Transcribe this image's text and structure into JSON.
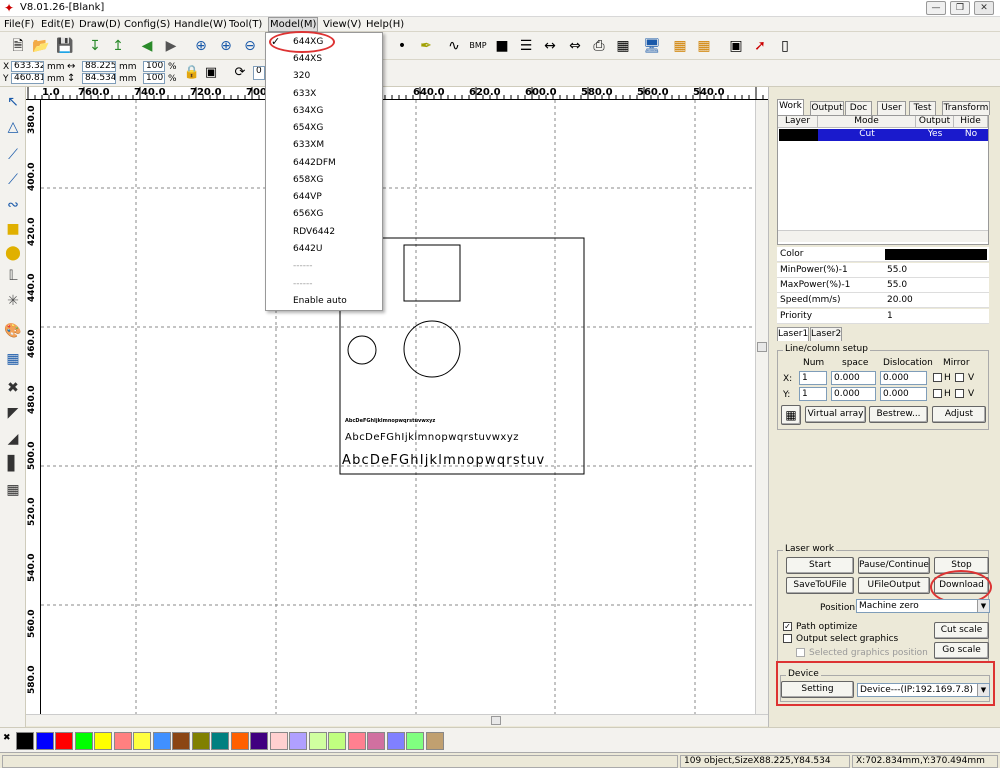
{
  "title": "V8.01.26-[Blank]",
  "menu": [
    {
      "name": "menu-file",
      "label": "File(F)"
    },
    {
      "name": "menu-edit",
      "label": "Edit(E)"
    },
    {
      "name": "menu-draw",
      "label": "Draw(D)"
    },
    {
      "name": "menu-config",
      "label": "Config(S)"
    },
    {
      "name": "menu-handle",
      "label": "Handle(W)"
    },
    {
      "name": "menu-tool",
      "label": "Tool(T)"
    },
    {
      "name": "menu-model",
      "label": "Model(M)"
    },
    {
      "name": "menu-view",
      "label": "View(V)"
    },
    {
      "name": "menu-help",
      "label": "Help(H)"
    }
  ],
  "coords": {
    "x_label": "X",
    "x_value": "633.326",
    "x_unit": "mm",
    "y_label": "Y",
    "y_value": "460.811",
    "y_unit": "mm",
    "w_value": "88.225",
    "w_unit": "mm",
    "h_value": "84.534",
    "h_unit": "mm",
    "sx_value": "100",
    "sx_unit": "%",
    "sy_value": "100",
    "sy_unit": "%",
    "rot_value": "0"
  },
  "model_menu": {
    "checked": "644XG",
    "items": [
      "644XG",
      "644XS",
      "320",
      "633X",
      "634XG",
      "654XG",
      "633XM",
      "6442DFM",
      "658XG",
      "644VP",
      "656XG",
      "RDV6442",
      "6442U",
      "------",
      "------",
      "Enable auto"
    ]
  },
  "ruler_h": [
    "1.0",
    "760.0",
    "740.0",
    "720.0",
    "700",
    "640.0",
    "620.0",
    "600.0",
    "580.0",
    "560.0",
    "540.0"
  ],
  "ruler_v": [
    "380.0",
    "400.0",
    "420.0",
    "440.0",
    "460.0",
    "480.0",
    "500.0",
    "520.0",
    "540.0",
    "560.0",
    "580.0"
  ],
  "canvas_text": {
    "line1": "AbcDeFGhIjklmnopwqrstuvwxyz",
    "line2": "AbcDeFGhIjklmnopwqrstuvwxyz",
    "line3": "AbcDeFGhIjklmnopwqrstuv"
  },
  "tabs": [
    "Work",
    "Output",
    "Doc",
    "User",
    "Test",
    "Transform"
  ],
  "layer_table": {
    "headers": [
      "Layer",
      "Mode",
      "Output",
      "Hide"
    ],
    "row": {
      "mode": "Cut",
      "output": "Yes",
      "hide": "No"
    }
  },
  "props": [
    {
      "label": "Color",
      "value": ""
    },
    {
      "label": "MinPower(%)-1",
      "value": "55.0"
    },
    {
      "label": "MaxPower(%)-1",
      "value": "55.0"
    },
    {
      "label": "Speed(mm/s)",
      "value": "20.00"
    },
    {
      "label": "Priority",
      "value": "1"
    }
  ],
  "laser_tabs": [
    "Laser1",
    "Laser2"
  ],
  "linecol": {
    "title": "Line/column setup",
    "col_num": "Num",
    "col_space": "space",
    "col_disloc": "Dislocation",
    "col_mirror": "Mirror",
    "x_label": "X:",
    "x_num": "1",
    "x_space": "0.000",
    "x_disloc": "0.000",
    "y_label": "Y:",
    "y_num": "1",
    "y_space": "0.000",
    "y_disloc": "0.000",
    "h": "H",
    "v": "V",
    "virtual_array": "Virtual array",
    "bestrew": "Bestrew...",
    "adjust": "Adjust"
  },
  "laserwork": {
    "title": "Laser work",
    "start": "Start",
    "pause": "Pause/Continue",
    "stop": "Stop",
    "save_u": "SaveToUFile",
    "ufile_output": "UFileOutput",
    "download": "Download",
    "position_label": "Position:",
    "position_value": "Machine zero",
    "path_optimize": "Path optimize",
    "output_select": "Output select graphics",
    "selected_pos": "Selected graphics position",
    "cut_scale": "Cut scale",
    "go_scale": "Go scale"
  },
  "device": {
    "title": "Device",
    "setting": "Setting",
    "value": "Device---(IP:192.169.7.8)"
  },
  "palette": [
    "#000000",
    "#0000ff",
    "#ff0000",
    "#00ff00",
    "#ffff00",
    "#ff8080",
    "#ffff40",
    "#4090ff",
    "#8b4513",
    "#808000",
    "#008080",
    "#ff6000",
    "#400080",
    "#ffd0d0",
    "#b0a0ff",
    "#d0ffa0",
    "#c0ff80",
    "#ff8090",
    "#d070a0",
    "#8080ff",
    "#80ff80",
    "#c0a070"
  ],
  "status": {
    "objects": "109 object,SizeX88.225,Y84.534",
    "pos": "X:702.834mm,Y:370.494mm"
  }
}
